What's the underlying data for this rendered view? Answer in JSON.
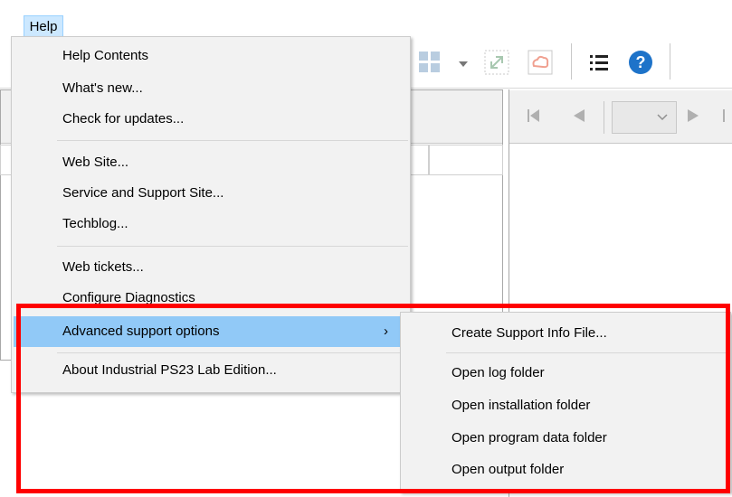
{
  "menubar": {
    "help_label": "Help"
  },
  "help_menu": {
    "items": [
      {
        "label": "Help Contents"
      },
      {
        "label": "What's new..."
      },
      {
        "label": "Check for updates..."
      },
      {
        "label": "Web Site..."
      },
      {
        "label": "Service and Support Site..."
      },
      {
        "label": "Techblog..."
      },
      {
        "label": "Web tickets..."
      },
      {
        "label": "Configure Diagnostics"
      },
      {
        "label": "Advanced support options",
        "submenu_arrow": "›"
      },
      {
        "label": "About Industrial PS23 Lab Edition..."
      }
    ]
  },
  "advanced_submenu": {
    "items": [
      {
        "label": "Create Support Info File..."
      },
      {
        "label": "Open log folder"
      },
      {
        "label": "Open installation folder"
      },
      {
        "label": "Open program data folder"
      },
      {
        "label": "Open output folder"
      }
    ]
  },
  "toolbar": {
    "icons": [
      "grid-view-icon",
      "dropdown-arrow-icon",
      "expand-icon",
      "cloud-icon",
      "list-icon",
      "help-icon"
    ],
    "help_icon_color": "#1e73c9"
  },
  "colors": {
    "highlight": "#91c9f7",
    "annotation": "#ff0000",
    "menu_bg": "#f2f2f2"
  }
}
